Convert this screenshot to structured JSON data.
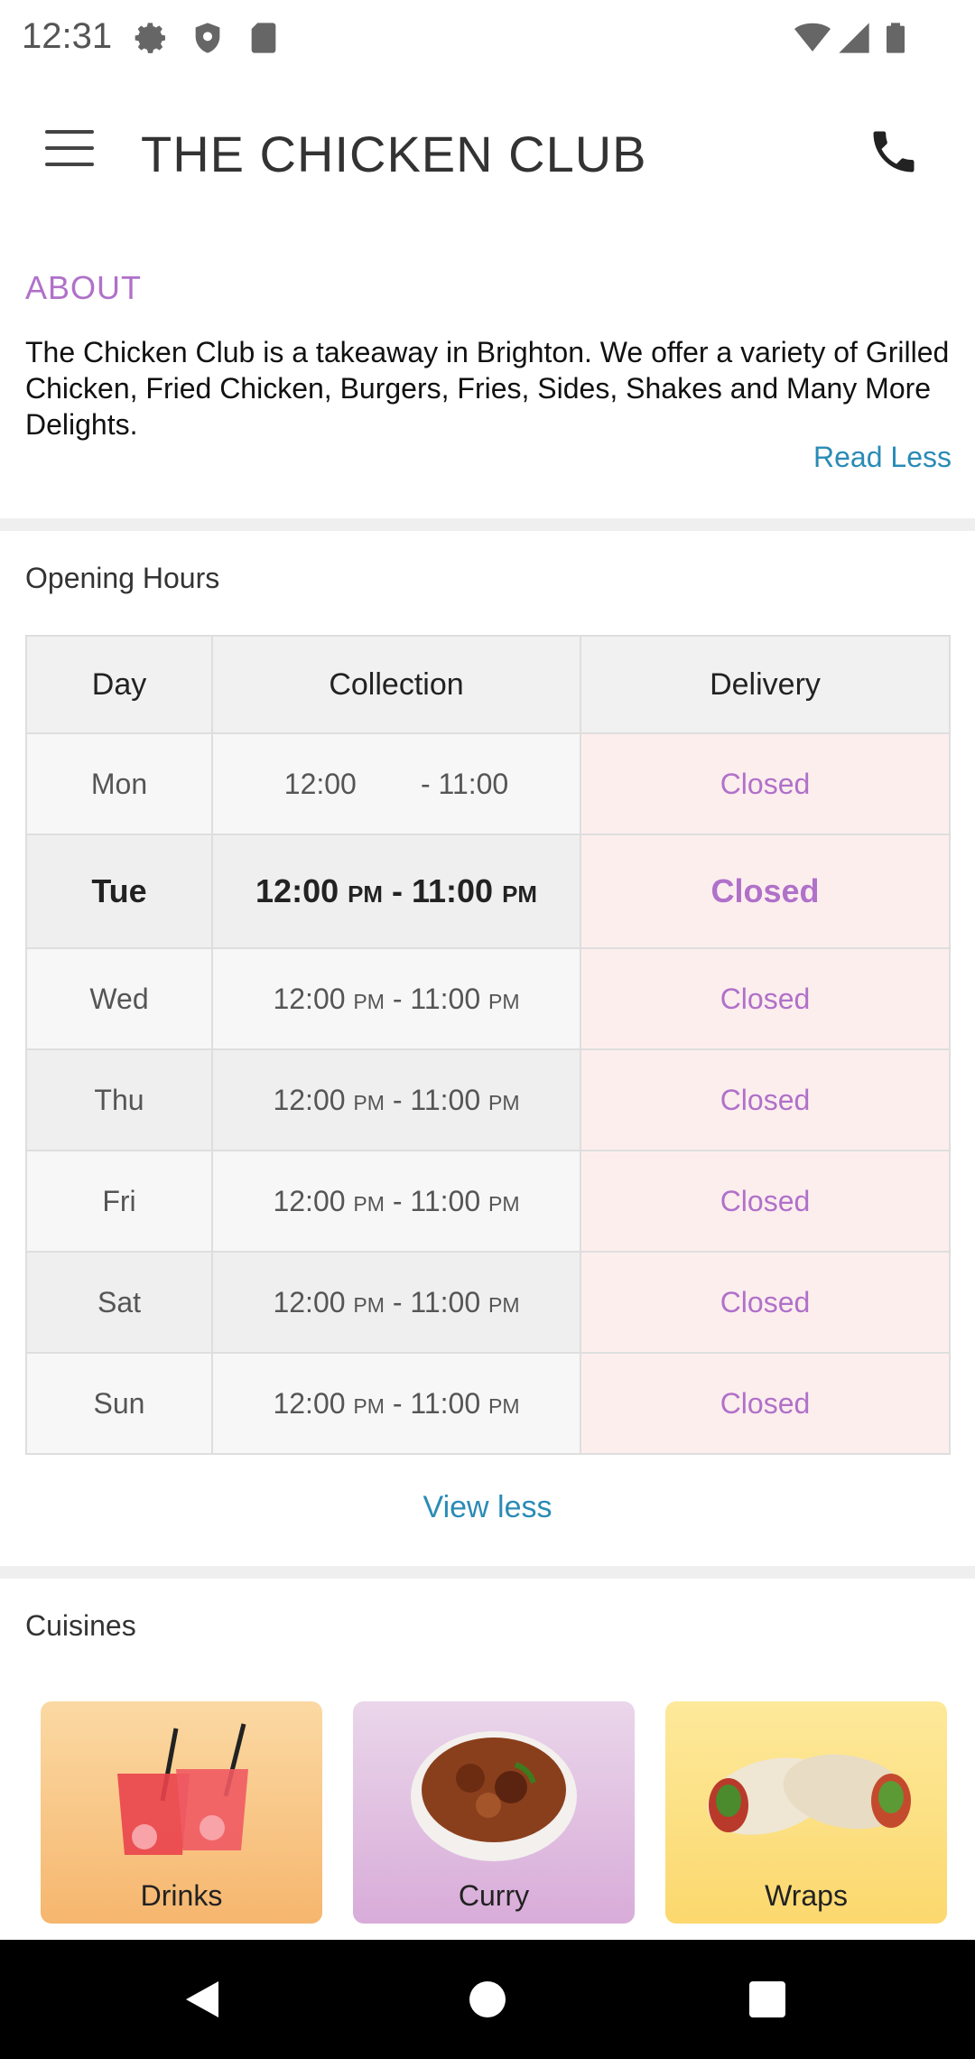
{
  "status_bar": {
    "time": "12:31"
  },
  "app_bar": {
    "title": "THE CHICKEN CLUB"
  },
  "about": {
    "heading": "ABOUT",
    "text": "The Chicken Club is a takeaway in Brighton. We offer a variety of Grilled Chicken, Fried Chicken, Burgers, Fries, Sides, Shakes and Many More Delights.",
    "read_less": "Read Less"
  },
  "opening_hours": {
    "heading": "Opening Hours",
    "columns": [
      "Day",
      "Collection",
      "Delivery"
    ],
    "rows": [
      {
        "day": "Mon",
        "start": "12:00",
        "start_suffix": "",
        "end": "11:00",
        "end_suffix": "",
        "delivery": "Closed"
      },
      {
        "day": "Tue",
        "start": "12:00",
        "start_suffix": "PM",
        "end": "11:00",
        "end_suffix": "PM",
        "delivery": "Closed"
      },
      {
        "day": "Wed",
        "start": "12:00",
        "start_suffix": "PM",
        "end": "11:00",
        "end_suffix": "PM",
        "delivery": "Closed"
      },
      {
        "day": "Thu",
        "start": "12:00",
        "start_suffix": "PM",
        "end": "11:00",
        "end_suffix": "PM",
        "delivery": "Closed"
      },
      {
        "day": "Fri",
        "start": "12:00",
        "start_suffix": "PM",
        "end": "11:00",
        "end_suffix": "PM",
        "delivery": "Closed"
      },
      {
        "day": "Sat",
        "start": "12:00",
        "start_suffix": "PM",
        "end": "11:00",
        "end_suffix": "PM",
        "delivery": "Closed"
      },
      {
        "day": "Sun",
        "start": "12:00",
        "start_suffix": "PM",
        "end": "11:00",
        "end_suffix": "PM",
        "delivery": "Closed"
      }
    ],
    "view_less": "View less"
  },
  "cuisines": {
    "heading": "Cuisines",
    "items": [
      {
        "label": "Drinks",
        "icon": "drinks-image"
      },
      {
        "label": "Curry",
        "icon": "curry-image"
      },
      {
        "label": "Wraps",
        "icon": "wraps-image"
      }
    ]
  },
  "colors": {
    "accent": "#b071c9",
    "link": "#2a8bb6",
    "closed_bg": "#fdeeee"
  }
}
